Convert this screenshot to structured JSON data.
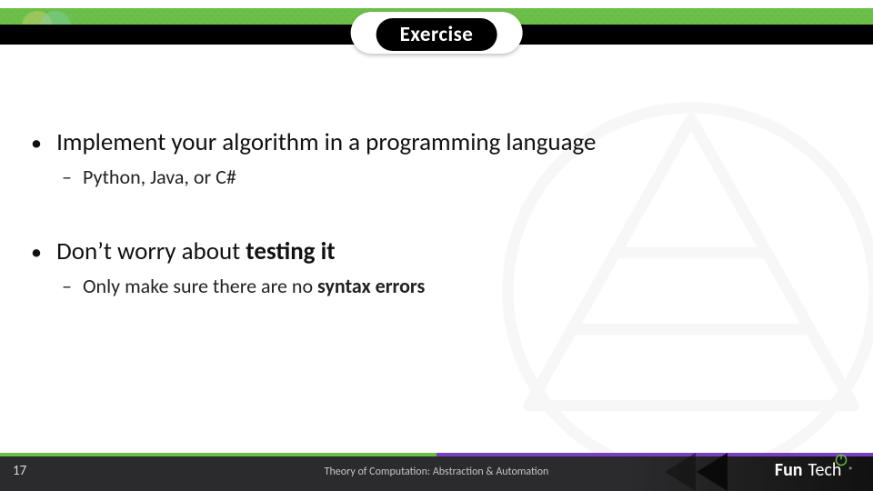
{
  "header": {
    "badge_label": "Exercise"
  },
  "bullets": [
    {
      "text_plain": "Implement your algorithm in a programming language",
      "text_bold": "",
      "sub": [
        {
          "text_plain": "Python, Java, or C#",
          "text_bold": ""
        }
      ]
    },
    {
      "text_plain": "Don’t worry about ",
      "text_bold": "testing it",
      "sub": [
        {
          "text_plain": "Only make sure there are no ",
          "text_bold": "syntax errors"
        }
      ]
    }
  ],
  "footer": {
    "slide_number": "17",
    "center_text": "Theory of Computation: Abstraction & Automation",
    "logo_primary": "Fun",
    "logo_secondary": "Tech"
  }
}
